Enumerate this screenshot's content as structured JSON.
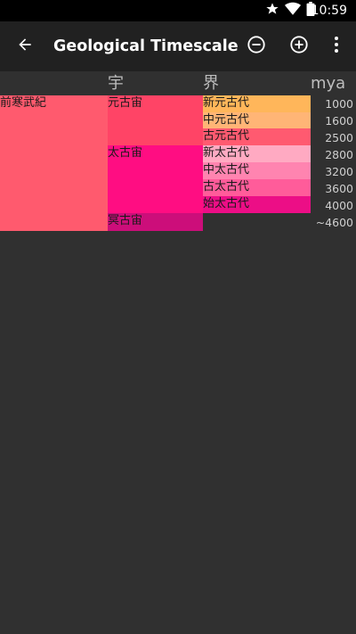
{
  "status_bar": {
    "time": "10:59",
    "icons": [
      "star-icon",
      "wifi-icon",
      "battery-icon"
    ]
  },
  "app_bar": {
    "title": "Geological Timescale",
    "back_icon": "arrow-back-icon",
    "zoom_out_icon": "minus-circle-icon",
    "zoom_in_icon": "plus-circle-icon",
    "menu_icon": "more-vert-icon"
  },
  "headers": {
    "eon": "宇",
    "era": "界",
    "mya": "mya"
  },
  "supereon": {
    "label": "前寒武紀",
    "color": "#ff5a6e"
  },
  "eons": [
    {
      "label": "元古宙",
      "color": "#ff4466"
    },
    {
      "label": "太古宙",
      "color": "#ff0d82"
    },
    {
      "label": "冥古宙",
      "color": "#cc0e7a"
    }
  ],
  "eras": [
    {
      "label": "新元古代",
      "color": "#ffb65a"
    },
    {
      "label": "中元古代",
      "color": "#ffb576"
    },
    {
      "label": "古元古代",
      "color": "#ff5a70"
    },
    {
      "label": "新太古代",
      "color": "#ffaac2"
    },
    {
      "label": "中太古代",
      "color": "#ff84b0"
    },
    {
      "label": "古太古代",
      "color": "#ff5c9a"
    },
    {
      "label": "始太古代",
      "color": "#ec0e86"
    }
  ],
  "mya_ticks": [
    "1000",
    "1600",
    "2500",
    "2800",
    "3200",
    "3600",
    "4000",
    "~4600"
  ]
}
